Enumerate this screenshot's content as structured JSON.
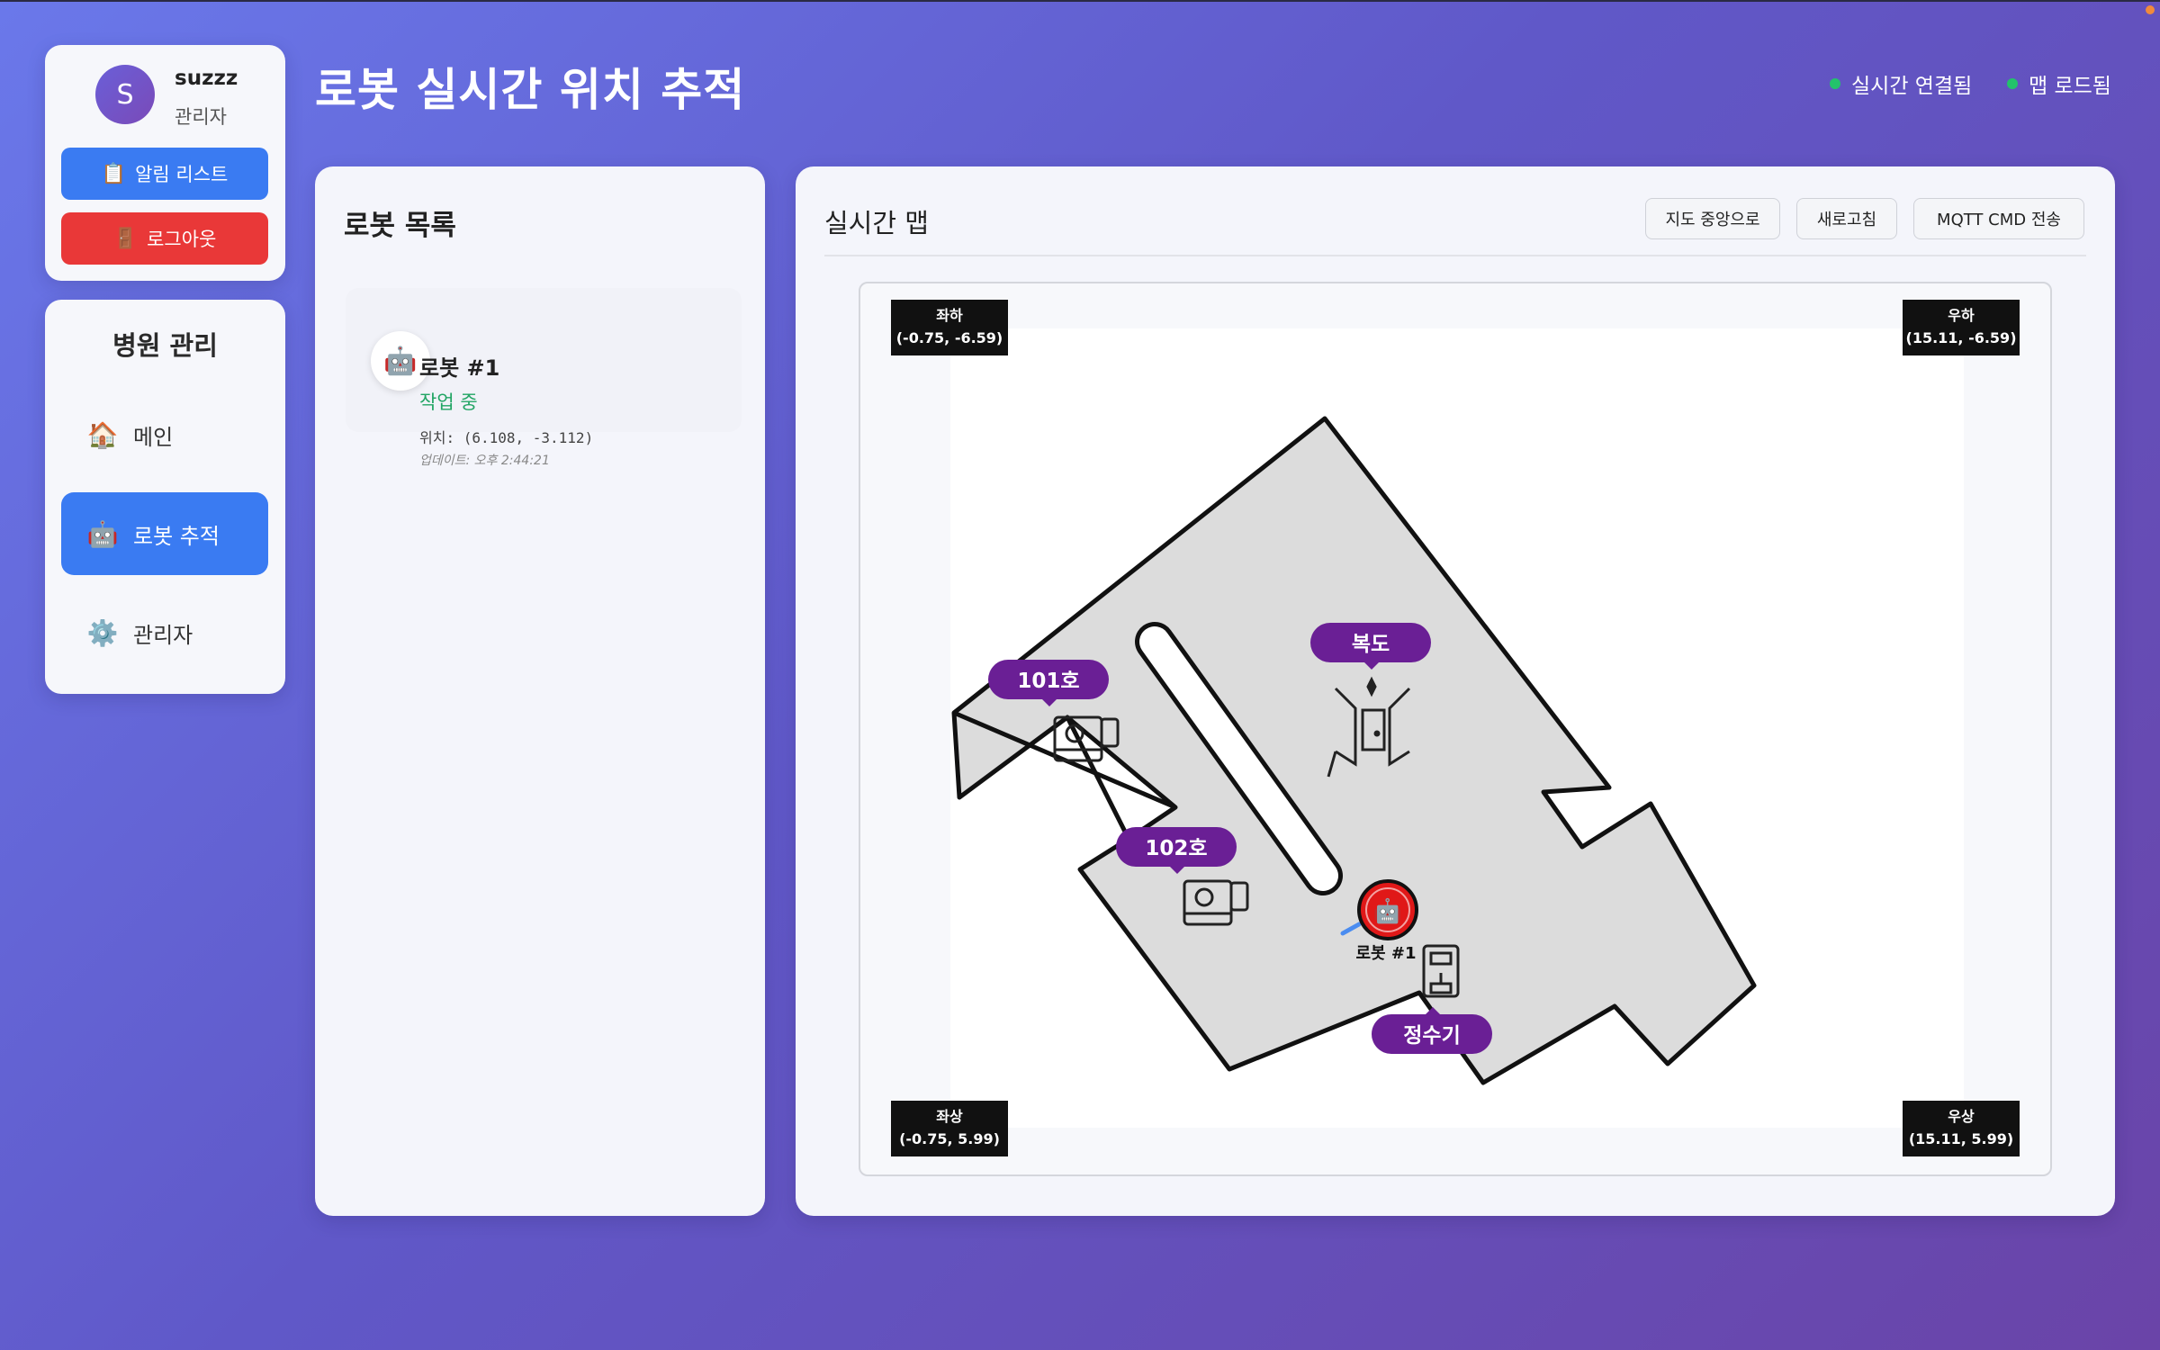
{
  "user": {
    "avatar_initial": "S",
    "name": "suzzz",
    "role": "관리자"
  },
  "sidebar_buttons": {
    "alert_icon": "📋",
    "alert_label": "알림 리스트",
    "logout_icon": "🚪",
    "logout_label": "로그아웃"
  },
  "nav": {
    "title": "병원 관리",
    "items": [
      {
        "icon": "🏠",
        "label": "메인"
      },
      {
        "icon": "🤖",
        "label": "로봇 추적"
      },
      {
        "icon": "⚙️",
        "label": "관리자"
      }
    ]
  },
  "header": {
    "title": "로봇 실시간 위치 추적",
    "status_connection": "실시간 연결됨",
    "status_map": "맵 로드됨"
  },
  "robot_list": {
    "title": "로봇 목록",
    "robots": [
      {
        "icon": "🤖",
        "name": "로봇 #1",
        "status": "작업 중",
        "position": "위치: (6.108, -3.112)",
        "updated": "업데이트: 오후 2:44:21"
      }
    ]
  },
  "map": {
    "title": "실시간 맵",
    "buttons": {
      "center": "지도 중앙으로",
      "refresh": "새로고침",
      "mqtt": "MQTT CMD 전송"
    },
    "corners": {
      "top_left": {
        "name": "좌하",
        "coord": "(-0.75, -6.59)"
      },
      "top_right": {
        "name": "우하",
        "coord": "(15.11, -6.59)"
      },
      "bottom_left": {
        "name": "좌상",
        "coord": "(-0.75, 5.99)"
      },
      "bottom_right": {
        "name": "우상",
        "coord": "(15.11, 5.99)"
      }
    },
    "rooms": {
      "r101": "101호",
      "r102": "102호",
      "corridor": "복도",
      "water": "정수기"
    },
    "robot_marker": {
      "icon": "🤖",
      "label": "로봇 #1"
    }
  },
  "colors": {
    "accent_blue": "#3a7bf2",
    "danger_red": "#e93838",
    "room_purple": "#6a1f95",
    "status_green": "#23c26b",
    "robot_red": "#e01818"
  }
}
